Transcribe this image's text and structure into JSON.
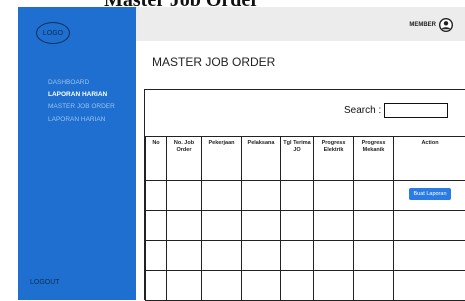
{
  "doc_title": "Master Job Order",
  "sidebar": {
    "logo": "LOGO",
    "items": [
      {
        "label": "DASHBOARD"
      },
      {
        "label": "LAPORAN HARIAN"
      },
      {
        "label": "MASTER JOB ORDER"
      },
      {
        "label": "LAPORAN HARIAN"
      }
    ],
    "active_index": 1,
    "logout": "LOGOUT"
  },
  "header": {
    "member_label": "MEMBER",
    "member_icon": "user-avatar-icon"
  },
  "main": {
    "title": "MASTER JOB ORDER",
    "search_label": "Search :",
    "search_value": "",
    "columns": [
      "No",
      "No. Job Order",
      "Pekerjaan",
      "Pelaksana",
      "Tgl Terima JO",
      "Progress Elektrik",
      "Progress Mekanik",
      "Action"
    ],
    "row_count": 4,
    "action_button": "Buat Laporan"
  },
  "colors": {
    "sidebar_bg": "#1e6fcf",
    "topbar_bg": "#ececec",
    "button_bg": "#2a7be4"
  }
}
